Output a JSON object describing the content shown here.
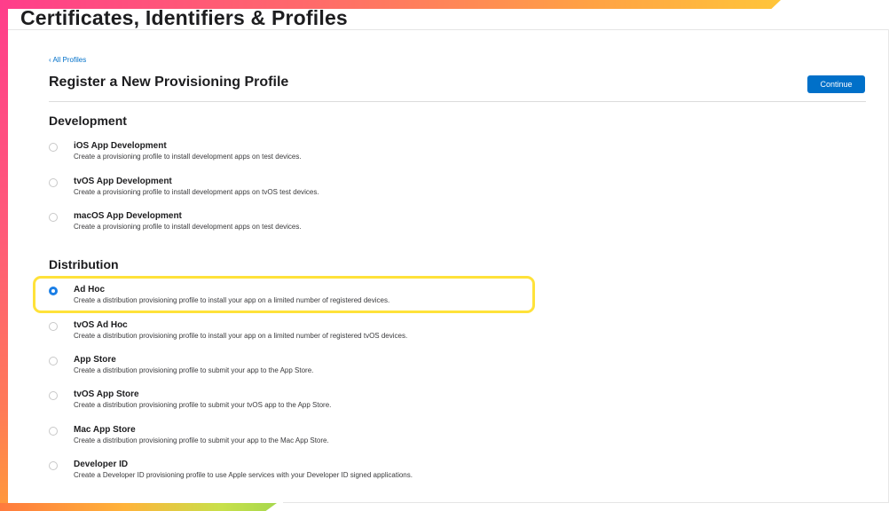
{
  "site": {
    "title": "Certificates, Identifiers & Profiles"
  },
  "header": {
    "back_link": "‹ All Profiles",
    "page_title": "Register a New Provisioning Profile",
    "continue_label": "Continue"
  },
  "colors": {
    "accent": "#0070c9",
    "highlight": "#ffe23a",
    "frame_gradient": [
      "#ff3d8b",
      "#ff7a57",
      "#ffc53a"
    ]
  },
  "development": {
    "heading": "Development",
    "options": [
      {
        "label": "iOS App Development",
        "description": "Create a provisioning profile to install development apps on test devices.",
        "selected": false
      },
      {
        "label": "tvOS App Development",
        "description": "Create a provisioning profile to install development apps on tvOS test devices.",
        "selected": false
      },
      {
        "label": "macOS App Development",
        "description": "Create a provisioning profile to install development apps on test devices.",
        "selected": false
      }
    ]
  },
  "distribution": {
    "heading": "Distribution",
    "options": [
      {
        "label": "Ad Hoc",
        "description": "Create a distribution provisioning profile to install your app on a limited number of registered devices.",
        "selected": true
      },
      {
        "label": "tvOS Ad Hoc",
        "description": "Create a distribution provisioning profile to install your app on a limited number of registered tvOS devices.",
        "selected": false
      },
      {
        "label": "App Store",
        "description": "Create a distribution provisioning profile to submit your app to the App Store.",
        "selected": false
      },
      {
        "label": "tvOS App Store",
        "description": "Create a distribution provisioning profile to submit your tvOS app to the App Store.",
        "selected": false
      },
      {
        "label": "Mac App Store",
        "description": "Create a distribution provisioning profile to submit your app to the Mac App Store.",
        "selected": false
      },
      {
        "label": "Developer ID",
        "description": "Create a Developer ID provisioning profile to use Apple services with your Developer ID signed applications.",
        "selected": false
      }
    ]
  }
}
